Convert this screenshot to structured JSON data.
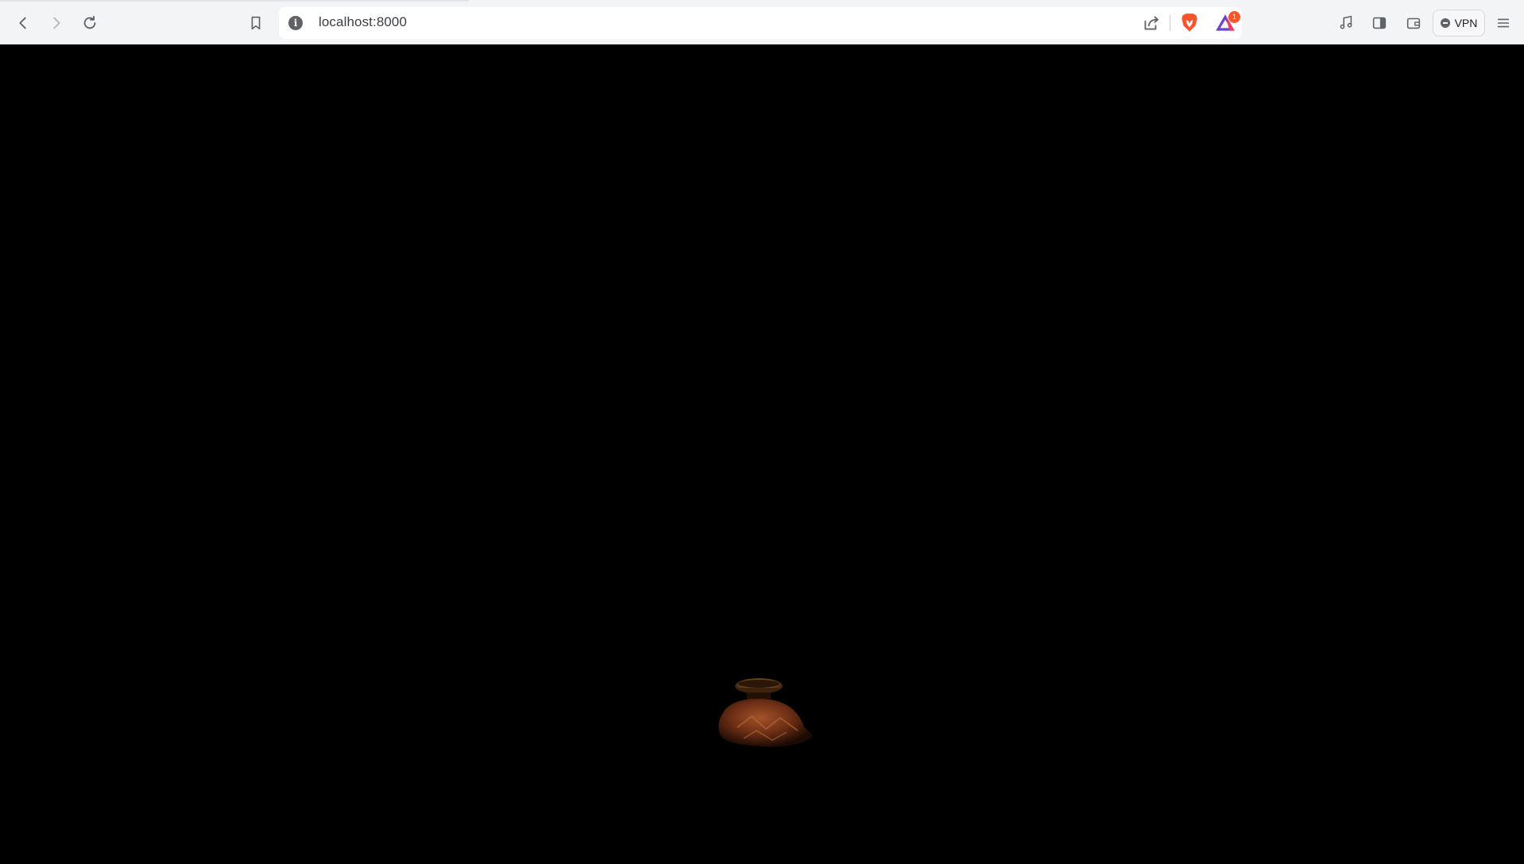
{
  "browser": {
    "address_bar": {
      "url": "localhost:8000"
    },
    "rewards_badge_count": "1",
    "vpn_label": "VPN"
  },
  "page": {
    "background_color": "#000000",
    "scene_object": "dimly lit 3D clay pot model"
  },
  "icons": {
    "back": "arrow-left-icon",
    "forward": "arrow-right-icon",
    "reload": "reload-icon",
    "bookmark": "bookmark-icon",
    "site_info": "info-icon",
    "share": "share-icon",
    "brave_shields": "brave-lion-icon",
    "rewards": "rewards-triangle-icon",
    "media": "music-note-icon",
    "sidebar": "sidebar-icon",
    "wallet": "wallet-icon",
    "menu": "hamburger-menu-icon"
  },
  "colors": {
    "toolbar_bg": "#f3f4f6",
    "brave_orange": "#fb542b",
    "rewards_purple": "#6b3fd4"
  }
}
